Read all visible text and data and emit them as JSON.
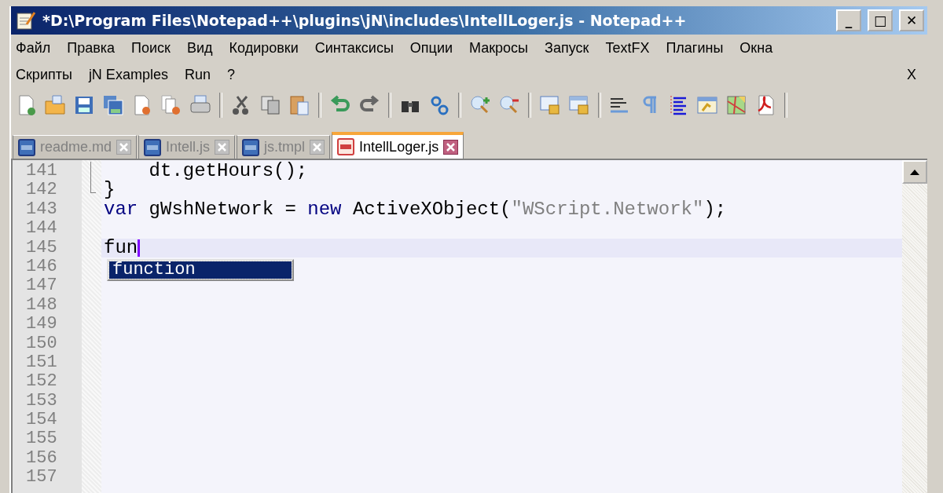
{
  "window": {
    "title": "*D:\\Program Files\\Notepad++\\plugins\\jN\\includes\\IntellLoger.js - Notepad++",
    "controls": [
      "_",
      "□",
      "✕"
    ]
  },
  "menu": {
    "row_1": [
      "Файл",
      "Правка",
      "Поиск",
      "Вид",
      "Кодировки",
      "Синтаксисы",
      "Опции",
      "Макросы",
      "Запуск",
      "TextFX",
      "Плагины",
      "Окна"
    ],
    "row_2": [
      "Скрипты",
      "jN Examples",
      "Run",
      "?"
    ],
    "close": "X"
  },
  "tabs": [
    {
      "label": "readme.md",
      "selected": false,
      "modified": false
    },
    {
      "label": "Intell.js",
      "selected": false,
      "modified": false
    },
    {
      "label": "js.tmpl",
      "selected": false,
      "modified": false
    },
    {
      "label": "IntellLoger.js",
      "selected": true,
      "modified": true
    }
  ],
  "editor": {
    "lines": [
      {
        "number": "141",
        "kind": "fold_body",
        "current": false,
        "tokens": [
          {
            "kind": "plain",
            "text": "    dt.getHours();"
          }
        ]
      },
      {
        "number": "142",
        "kind": "fold_end",
        "current": false,
        "tokens": [
          {
            "kind": "plain",
            "text": "}"
          }
        ]
      },
      {
        "number": "143",
        "kind": "plain",
        "current": false,
        "tokens": [
          {
            "kind": "keyword",
            "text": "var"
          },
          {
            "kind": "plain",
            "text": " gWshNetwork = "
          },
          {
            "kind": "keyword",
            "text": "new"
          },
          {
            "kind": "plain",
            "text": " ActiveXObject("
          },
          {
            "kind": "string",
            "text": "\"WScript.Network\""
          },
          {
            "kind": "plain",
            "text": ");"
          }
        ]
      },
      {
        "number": "144",
        "kind": "plain",
        "current": false
      },
      {
        "number": "145",
        "kind": "plain",
        "current": true,
        "tokens": [
          {
            "kind": "plain",
            "text": "fun"
          }
        ]
      },
      {
        "number": "146",
        "kind": "plain",
        "current": false
      },
      {
        "number": "147",
        "kind": "plain",
        "current": false
      },
      {
        "number": "148",
        "kind": "plain",
        "current": false
      },
      {
        "number": "149",
        "kind": "plain",
        "current": false
      },
      {
        "number": "150",
        "kind": "plain",
        "current": false
      },
      {
        "number": "151",
        "kind": "plain",
        "current": false
      },
      {
        "number": "152",
        "kind": "plain",
        "current": false
      },
      {
        "number": "153",
        "kind": "plain",
        "current": false
      },
      {
        "number": "154",
        "kind": "plain",
        "current": false
      },
      {
        "number": "155",
        "kind": "plain",
        "current": false
      },
      {
        "number": "156",
        "kind": "plain",
        "current": false
      },
      {
        "number": "157",
        "kind": "plain",
        "current": false
      }
    ],
    "autocomplete": [
      {
        "label": "function",
        "selected": true
      }
    ]
  }
}
